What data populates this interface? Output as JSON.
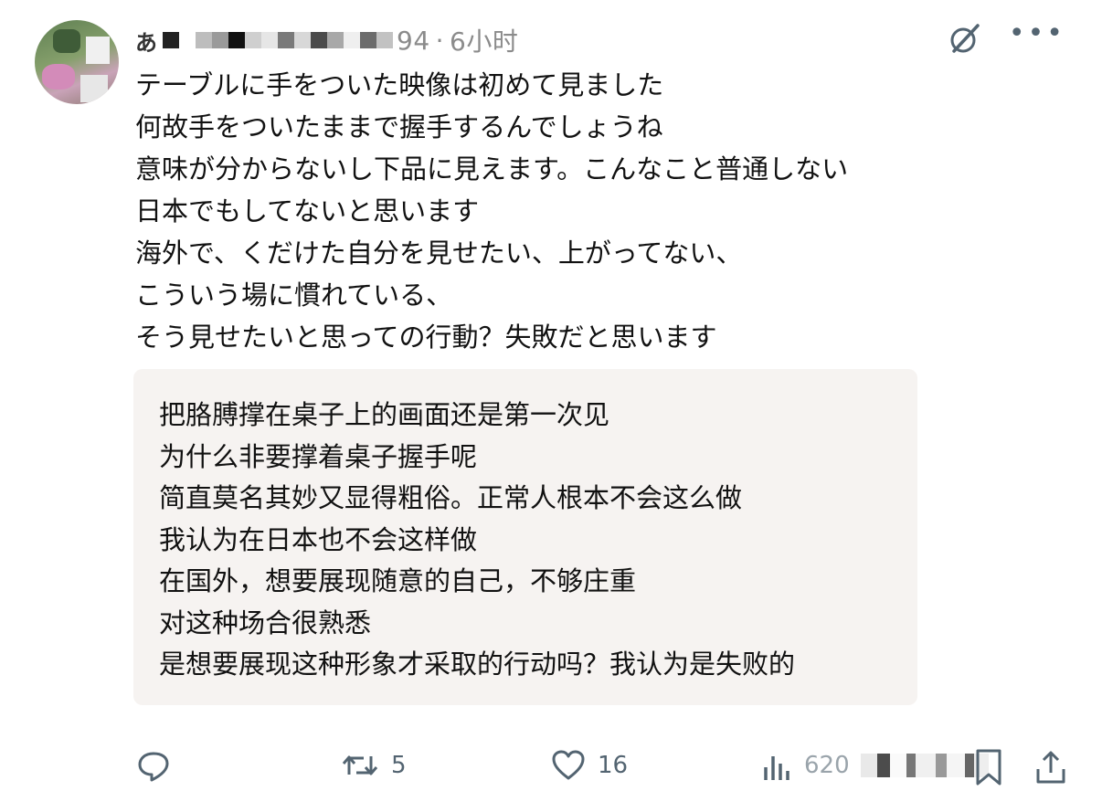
{
  "post": {
    "author_partial": "あ",
    "handle_tail": "94",
    "separator": "·",
    "time": "6小时",
    "original_lines": [
      "テーブルに手をついた映像は初めて見ました",
      "何故手をついたままで握手するんでしょうね",
      "意味が分からないし下品に見えます。こんなこと普通しない",
      "日本でもしてないと思います",
      "海外で、くだけた自分を見せたい、上がってない、",
      "こういう場に慣れている、",
      "そう見せたいと思っての行動？失敗だと思います"
    ],
    "translation_lines": [
      "把胳膊撑在桌子上的画面还是第一次见",
      "为什么非要撑着桌子握手呢",
      "简直莫名其妙又显得粗俗。正常人根本不会这么做",
      "我认为在日本也不会这样做",
      "在国外，想要展现随意的自己，不够庄重",
      "对这种场合很熟悉",
      "是想要展现这种形象才采取的行动吗？我认为是失败的"
    ]
  },
  "actions": {
    "reply_count": "",
    "repost_count": "5",
    "like_count": "16",
    "views_partial": "620"
  },
  "icons": {
    "grok": "grok-icon",
    "more": "more-icon",
    "reply": "reply-icon",
    "repost": "repost-icon",
    "like": "heart-icon",
    "views": "views-icon",
    "bookmark": "bookmark-icon",
    "share": "share-icon"
  },
  "colors": {
    "text": "#0f1419",
    "muted": "#536471",
    "translation_bg": "#f6f3f1"
  }
}
